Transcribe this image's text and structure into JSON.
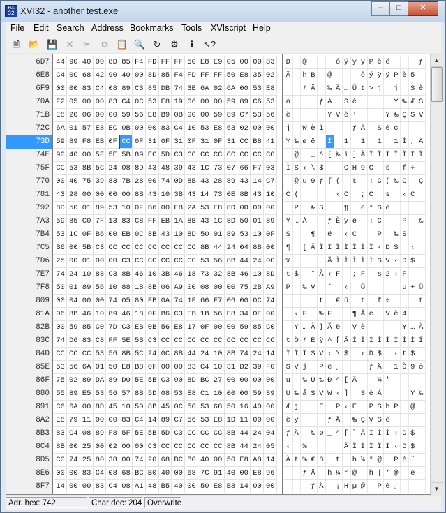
{
  "window": {
    "title": "XVI32 - another test.exe",
    "icon": "app-icon",
    "caption_buttons": [
      "minimize-icon",
      "maximize-icon",
      "close-icon"
    ]
  },
  "menu": [
    "File",
    "Edit",
    "Search",
    "Address",
    "Bookmarks",
    "Tools",
    "XVIscript",
    "Help"
  ],
  "toolbar": [
    "new-file-icon",
    "open-file-icon",
    "save-icon",
    "close-file-icon",
    "cut-icon",
    "copy-icon",
    "paste-icon",
    "find-icon",
    "replace-icon",
    "properties-icon",
    "script-icon",
    "help-icon"
  ],
  "rows": [
    {
      "addr": "6D7",
      "hex": [
        "44",
        "90",
        "40",
        "00",
        "8D",
        "85",
        "F4",
        "FD",
        "FF",
        "FF",
        "50",
        "E8",
        "E9",
        "05",
        "00",
        "00",
        "83"
      ],
      "chars": [
        "D",
        "",
        "@",
        "",
        "",
        "",
        "ô",
        "ý",
        "ÿ",
        "ÿ",
        "P",
        "è",
        "é",
        "",
        "",
        "",
        "ƒ"
      ]
    },
    {
      "addr": "6E8",
      "hex": [
        "C4",
        "0C",
        "68",
        "42",
        "90",
        "40",
        "00",
        "8D",
        "85",
        "F4",
        "FD",
        "FF",
        "FF",
        "50",
        "E8",
        "35",
        "02"
      ],
      "chars": [
        "Ä",
        "",
        "h",
        "B",
        "",
        "@",
        "",
        "",
        "",
        "ô",
        "ý",
        "ÿ",
        "ÿ",
        "P",
        "è",
        "5",
        ""
      ]
    },
    {
      "addr": "6F9",
      "hex": [
        "00",
        "00",
        "83",
        "C4",
        "08",
        "89",
        "C3",
        "85",
        "DB",
        "74",
        "3E",
        "6A",
        "02",
        "6A",
        "00",
        "53",
        "E8"
      ],
      "chars": [
        "",
        "",
        "ƒ",
        "Ä",
        "",
        "‰",
        "Ã",
        "…",
        "Û",
        "t",
        ">",
        "j",
        "",
        "j",
        "",
        "S",
        "è"
      ]
    },
    {
      "addr": "70A",
      "hex": [
        "F2",
        "05",
        "00",
        "00",
        "83",
        "C4",
        "0C",
        "53",
        "E8",
        "19",
        "06",
        "00",
        "00",
        "59",
        "89",
        "C6",
        "53"
      ],
      "chars": [
        "ò",
        "",
        "",
        "",
        "ƒ",
        "Ä",
        "",
        "S",
        "è",
        "",
        "",
        "",
        "",
        "Y",
        "‰",
        "Æ",
        "S"
      ]
    },
    {
      "addr": "71B",
      "hex": [
        "E8",
        "20",
        "06",
        "00",
        "00",
        "59",
        "56",
        "E8",
        "B9",
        "0B",
        "00",
        "00",
        "59",
        "89",
        "C7",
        "53",
        "56"
      ],
      "chars": [
        "è",
        "",
        "",
        "",
        "",
        "Y",
        "V",
        "è",
        "¹",
        "",
        "",
        "",
        "Y",
        "‰",
        "Ç",
        "S",
        "V"
      ]
    },
    {
      "addr": "72C",
      "hex": [
        "6A",
        "01",
        "57",
        "E8",
        "EC",
        "0B",
        "00",
        "00",
        "83",
        "C4",
        "10",
        "53",
        "E8",
        "63",
        "02",
        "00",
        "00"
      ],
      "chars": [
        "j",
        "",
        "W",
        "è",
        "ì",
        "",
        "",
        "",
        "ƒ",
        "Ä",
        "",
        "S",
        "è",
        "c",
        "",
        "",
        ""
      ]
    },
    {
      "addr": "73D",
      "hex": [
        "59",
        "89",
        "F8",
        "EB",
        "0F",
        "CC",
        "0F",
        "31",
        "0F",
        "31",
        "0F",
        "31",
        "0F",
        "31",
        "CC",
        "B8",
        "41"
      ],
      "chars": [
        "Y",
        "‰",
        "ø",
        "ë",
        "",
        "Ì",
        "",
        "1",
        "",
        "1",
        "",
        "1",
        "",
        "1",
        "Ì",
        "¸",
        "A"
      ]
    },
    {
      "addr": "74E",
      "hex": [
        "90",
        "40",
        "00",
        "5F",
        "5E",
        "5B",
        "89",
        "EC",
        "5D",
        "C3",
        "CC",
        "CC",
        "CC",
        "CC",
        "CC",
        "CC",
        "CC"
      ],
      "chars": [
        "",
        "@",
        "",
        "_",
        "^",
        "[",
        "‰",
        "ì",
        "]",
        "Ã",
        "Ì",
        "Ì",
        "Ì",
        "Ì",
        "Ì",
        "Ì",
        "Ì"
      ]
    },
    {
      "addr": "75F",
      "hex": [
        "CC",
        "53",
        "8B",
        "5C",
        "24",
        "08",
        "8D",
        "43",
        "48",
        "39",
        "43",
        "1C",
        "73",
        "07",
        "66",
        "F7",
        "03"
      ],
      "chars": [
        "Ì",
        "S",
        "‹",
        "\\",
        "$",
        "",
        "",
        "C",
        "H",
        "9",
        "C",
        "",
        "s",
        "",
        "f",
        "÷",
        ""
      ]
    },
    {
      "addr": "770",
      "hex": [
        "00",
        "40",
        "75",
        "39",
        "83",
        "7B",
        "28",
        "00",
        "74",
        "0D",
        "8B",
        "43",
        "28",
        "89",
        "43",
        "14",
        "C7"
      ],
      "chars": [
        "",
        "@",
        "u",
        "9",
        "ƒ",
        "{",
        "(",
        "",
        "t",
        "",
        "‹",
        "C",
        "(",
        "‰",
        "C",
        "",
        "Ç"
      ]
    },
    {
      "addr": "781",
      "hex": [
        "43",
        "28",
        "00",
        "00",
        "00",
        "00",
        "8B",
        "43",
        "10",
        "3B",
        "43",
        "14",
        "73",
        "0E",
        "8B",
        "43",
        "10"
      ],
      "chars": [
        "C",
        "(",
        "",
        "",
        "",
        "",
        "‹",
        "C",
        "",
        ";",
        "C",
        "",
        "s",
        "",
        "‹",
        "C",
        ""
      ]
    },
    {
      "addr": "792",
      "hex": [
        "8D",
        "50",
        "01",
        "89",
        "53",
        "10",
        "0F",
        "B6",
        "00",
        "EB",
        "2A",
        "53",
        "E8",
        "8D",
        "0D",
        "00",
        "00"
      ],
      "chars": [
        "",
        "P",
        "",
        "‰",
        "S",
        "",
        "",
        "¶",
        "",
        "ë",
        "*",
        "S",
        "è",
        "",
        "",
        "",
        ""
      ]
    },
    {
      "addr": "7A3",
      "hex": [
        "59",
        "85",
        "C0",
        "7F",
        "13",
        "83",
        "C8",
        "FF",
        "EB",
        "1A",
        "8B",
        "43",
        "1C",
        "8D",
        "50",
        "01",
        "89"
      ],
      "chars": [
        "Y",
        "…",
        "À",
        "",
        "",
        "ƒ",
        "È",
        "ÿ",
        "ë",
        "",
        "‹",
        "C",
        "",
        "",
        "P",
        "",
        "‰"
      ]
    },
    {
      "addr": "7B4",
      "hex": [
        "53",
        "1C",
        "0F",
        "B6",
        "00",
        "EB",
        "0C",
        "8B",
        "43",
        "10",
        "8D",
        "50",
        "01",
        "89",
        "53",
        "10",
        "0F"
      ],
      "chars": [
        "S",
        "",
        "",
        "¶",
        "",
        "ë",
        "",
        "‹",
        "C",
        "",
        "",
        "P",
        "",
        "‰",
        "S",
        "",
        ""
      ]
    },
    {
      "addr": "7C5",
      "hex": [
        "B6",
        "00",
        "5B",
        "C3",
        "CC",
        "CC",
        "CC",
        "CC",
        "CC",
        "CC",
        "CC",
        "8B",
        "44",
        "24",
        "04",
        "8B",
        "00"
      ],
      "chars": [
        "¶",
        "",
        "[",
        "Ã",
        "Ì",
        "Ì",
        "Ì",
        "Ì",
        "Ì",
        "Ì",
        "Ì",
        "‹",
        "D",
        "$",
        "",
        "‹",
        ""
      ]
    },
    {
      "addr": "7D6",
      "hex": [
        "25",
        "00",
        "01",
        "00",
        "00",
        "C3",
        "CC",
        "CC",
        "CC",
        "CC",
        "CC",
        "53",
        "56",
        "8B",
        "44",
        "24",
        "0C"
      ],
      "chars": [
        "%",
        "",
        "",
        "",
        "",
        "Ã",
        "Ì",
        "Ì",
        "Ì",
        "Ì",
        "Ì",
        "S",
        "V",
        "‹",
        "D",
        "$",
        ""
      ]
    },
    {
      "addr": "7E7",
      "hex": [
        "74",
        "24",
        "10",
        "88",
        "C3",
        "8B",
        "46",
        "10",
        "3B",
        "46",
        "18",
        "73",
        "32",
        "8B",
        "46",
        "10",
        "8D"
      ],
      "chars": [
        "t",
        "$",
        "",
        "ˆ",
        "Ã",
        "‹",
        "F",
        "",
        ";",
        "F",
        "",
        "s",
        "2",
        "‹",
        "F",
        "",
        ""
      ]
    },
    {
      "addr": "7F8",
      "hex": [
        "50",
        "01",
        "89",
        "56",
        "10",
        "88",
        "18",
        "8B",
        "06",
        "A9",
        "00",
        "08",
        "00",
        "00",
        "75",
        "2B",
        "A9"
      ],
      "chars": [
        "P",
        "",
        "‰",
        "V",
        "",
        "ˆ",
        "",
        "‹",
        "",
        "©",
        "",
        "",
        "",
        "",
        "u",
        "+",
        "©"
      ]
    },
    {
      "addr": "809",
      "hex": [
        "00",
        "04",
        "00",
        "00",
        "74",
        "05",
        "80",
        "FB",
        "0A",
        "74",
        "1F",
        "66",
        "F7",
        "06",
        "00",
        "0C",
        "74"
      ],
      "chars": [
        "",
        "",
        "",
        "",
        "t",
        "",
        "€",
        "û",
        "",
        "t",
        "",
        "f",
        "÷",
        "",
        "",
        "",
        "t"
      ]
    },
    {
      "addr": "81A",
      "hex": [
        "06",
        "8B",
        "46",
        "10",
        "89",
        "46",
        "18",
        "0F",
        "B6",
        "C3",
        "EB",
        "1B",
        "56",
        "E8",
        "34",
        "0E",
        "00"
      ],
      "chars": [
        "",
        "‹",
        "F",
        "",
        "‰",
        "F",
        "",
        "",
        "¶",
        "Ã",
        "ë",
        "",
        "V",
        "è",
        "4",
        "",
        ""
      ]
    },
    {
      "addr": "82B",
      "hex": [
        "00",
        "59",
        "85",
        "C0",
        "7D",
        "C3",
        "EB",
        "0B",
        "56",
        "E8",
        "17",
        "0F",
        "00",
        "00",
        "59",
        "85",
        "C0"
      ],
      "chars": [
        "",
        "Y",
        "…",
        "À",
        "}",
        "Ã",
        "ë",
        "",
        "V",
        "è",
        "",
        "",
        "",
        "",
        "Y",
        "…",
        "À"
      ]
    },
    {
      "addr": "83C",
      "hex": [
        "74",
        "D6",
        "83",
        "C8",
        "FF",
        "5E",
        "5B",
        "C3",
        "CC",
        "CC",
        "CC",
        "CC",
        "CC",
        "CC",
        "CC",
        "CC",
        "CC"
      ],
      "chars": [
        "t",
        "Ö",
        "ƒ",
        "È",
        "ÿ",
        "^",
        "[",
        "Ã",
        "Ì",
        "Ì",
        "Ì",
        "Ì",
        "Ì",
        "Ì",
        "Ì",
        "Ì",
        "Ì"
      ]
    },
    {
      "addr": "84D",
      "hex": [
        "CC",
        "CC",
        "CC",
        "53",
        "56",
        "8B",
        "5C",
        "24",
        "0C",
        "8B",
        "44",
        "24",
        "10",
        "8B",
        "74",
        "24",
        "14"
      ],
      "chars": [
        "Ì",
        "Ì",
        "Ì",
        "S",
        "V",
        "‹",
        "\\",
        "$",
        "",
        "‹",
        "D",
        "$",
        "",
        "‹",
        "t",
        "$",
        ""
      ]
    },
    {
      "addr": "85E",
      "hex": [
        "53",
        "56",
        "6A",
        "01",
        "50",
        "E8",
        "B8",
        "0F",
        "00",
        "00",
        "83",
        "C4",
        "10",
        "31",
        "D2",
        "39",
        "F0"
      ],
      "chars": [
        "S",
        "V",
        "j",
        "",
        "P",
        "è",
        "¸",
        "",
        "",
        "",
        "ƒ",
        "Ä",
        "",
        "1",
        "Ò",
        "9",
        "ð"
      ]
    },
    {
      "addr": "86F",
      "hex": [
        "75",
        "02",
        "89",
        "DA",
        "89",
        "D0",
        "5E",
        "5B",
        "C3",
        "90",
        "8D",
        "BC",
        "27",
        "00",
        "00",
        "00",
        "00"
      ],
      "chars": [
        "u",
        "",
        "‰",
        "Ú",
        "‰",
        "Ð",
        "^",
        "[",
        "Ã",
        "",
        "",
        "¼",
        "'",
        "",
        "",
        "",
        ""
      ]
    },
    {
      "addr": "880",
      "hex": [
        "55",
        "89",
        "E5",
        "53",
        "56",
        "57",
        "8B",
        "5D",
        "08",
        "53",
        "E8",
        "C1",
        "10",
        "00",
        "00",
        "59",
        "89"
      ],
      "chars": [
        "U",
        "‰",
        "å",
        "S",
        "V",
        "W",
        "‹",
        "]",
        "",
        "S",
        "è",
        "Á",
        "",
        "",
        "",
        "Y",
        "‰"
      ]
    },
    {
      "addr": "891",
      "hex": [
        "C6",
        "6A",
        "00",
        "8D",
        "45",
        "10",
        "50",
        "8B",
        "45",
        "0C",
        "50",
        "53",
        "68",
        "50",
        "16",
        "40",
        "00"
      ],
      "chars": [
        "Æ",
        "j",
        "",
        "",
        "E",
        "",
        "P",
        "‹",
        "E",
        "",
        "P",
        "S",
        "h",
        "P",
        "",
        "@",
        ""
      ]
    },
    {
      "addr": "8A2",
      "hex": [
        "E8",
        "79",
        "11",
        "00",
        "00",
        "83",
        "C4",
        "14",
        "89",
        "C7",
        "56",
        "53",
        "E8",
        "1D",
        "11",
        "00",
        "00"
      ],
      "chars": [
        "è",
        "y",
        "",
        "",
        "",
        "ƒ",
        "Ä",
        "",
        "‰",
        "Ç",
        "V",
        "S",
        "è",
        "",
        "",
        "",
        ""
      ]
    },
    {
      "addr": "8B3",
      "hex": [
        "83",
        "C4",
        "08",
        "89",
        "F8",
        "5F",
        "5E",
        "5B",
        "5D",
        "C3",
        "CC",
        "CC",
        "CC",
        "8B",
        "44",
        "24",
        "04"
      ],
      "chars": [
        "ƒ",
        "Ä",
        "",
        "‰",
        "ø",
        "_",
        "^",
        "[",
        "]",
        "Ã",
        "Ì",
        "Ì",
        "Ì",
        "‹",
        "D",
        "$",
        ""
      ]
    },
    {
      "addr": "8C4",
      "hex": [
        "8B",
        "00",
        "25",
        "00",
        "02",
        "00",
        "00",
        "C3",
        "CC",
        "CC",
        "CC",
        "CC",
        "CC",
        "8B",
        "44",
        "24",
        "05"
      ],
      "chars": [
        "‹",
        "",
        "%",
        "",
        "",
        "",
        "",
        "Ã",
        "Ì",
        "Ì",
        "Ì",
        "Ì",
        "Ì",
        "‹",
        "D",
        "$",
        ""
      ]
    },
    {
      "addr": "8D5",
      "hex": [
        "C0",
        "74",
        "25",
        "80",
        "38",
        "00",
        "74",
        "20",
        "68",
        "BC",
        "B0",
        "40",
        "00",
        "50",
        "E8",
        "A8",
        "14"
      ],
      "chars": [
        "À",
        "t",
        "%",
        "€",
        "8",
        "",
        "t",
        "",
        "h",
        "¼",
        "°",
        "@",
        "",
        "P",
        "è",
        "¨",
        ""
      ]
    },
    {
      "addr": "8E6",
      "hex": [
        "00",
        "00",
        "83",
        "C4",
        "08",
        "68",
        "BC",
        "B0",
        "40",
        "00",
        "68",
        "7C",
        "91",
        "40",
        "00",
        "E8",
        "96"
      ],
      "chars": [
        "",
        "",
        "ƒ",
        "Ä",
        "",
        "h",
        "¼",
        "°",
        "@",
        "",
        "h",
        "|",
        "‘",
        "@",
        "",
        "è",
        "–"
      ]
    },
    {
      "addr": "8F7",
      "hex": [
        "14",
        "00",
        "00",
        "83",
        "C4",
        "08",
        "A1",
        "48",
        "B5",
        "40",
        "00",
        "50",
        "E8",
        "B8",
        "14",
        "00",
        "00"
      ],
      "chars": [
        "",
        "",
        "",
        "ƒ",
        "Ä",
        "",
        "¡",
        "H",
        "µ",
        "@",
        "",
        "P",
        "è",
        "¸",
        "",
        "",
        ""
      ]
    }
  ],
  "status": {
    "address": "Adr. hex: 742",
    "char": "Char dec: 204",
    "mode": "Overwrite"
  },
  "accent": "#3399ff"
}
